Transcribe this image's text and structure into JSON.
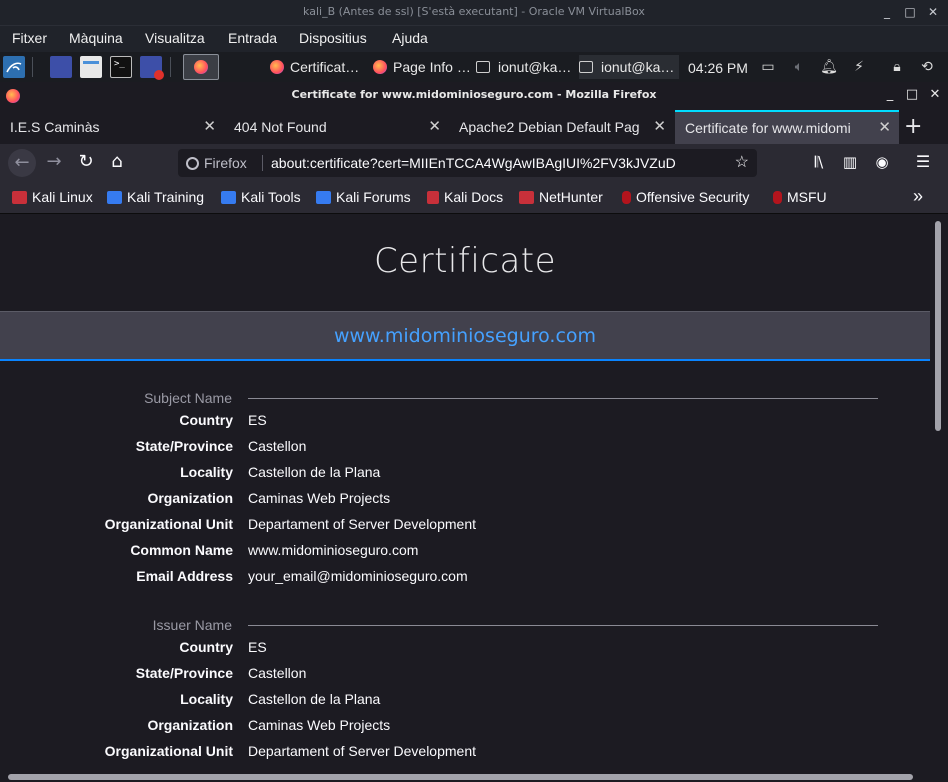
{
  "vbox": {
    "title": "kali_B (Antes de ssl) [S'està executant] - Oracle VM VirtualBox",
    "menu": [
      "Fitxer",
      "Màquina",
      "Visualitza",
      "Entrada",
      "Dispositius",
      "Ajuda"
    ]
  },
  "taskbar": {
    "tasks": [
      "Certificat…",
      "Page Info …",
      "ionut@ka…",
      "ionut@ka…"
    ],
    "clock": "04:26 PM"
  },
  "firefox": {
    "window_title": "Certificate for www.midominioseguro.com - Mozilla Firefox",
    "tabs": [
      {
        "label": "I.E.S Caminàs",
        "active": false
      },
      {
        "label": "404 Not Found",
        "active": false
      },
      {
        "label": "Apache2 Debian Default Pag",
        "active": false
      },
      {
        "label": "Certificate for www.midomi",
        "active": true
      }
    ],
    "identity_label": "Firefox",
    "url": "about:certificate?cert=MIIEnTCCA4WgAwIBAgIUI%2FV3kJVZuD",
    "bookmarks": [
      {
        "label": "Kali Linux",
        "icon": "kali-icon"
      },
      {
        "label": "Kali Training",
        "icon": "kali-training-icon"
      },
      {
        "label": "Kali Tools",
        "icon": "kali-tools-icon"
      },
      {
        "label": "Kali Forums",
        "icon": "kali-forums-icon"
      },
      {
        "label": "Kali Docs",
        "icon": "kali-docs-icon"
      },
      {
        "label": "NetHunter",
        "icon": "kali-icon"
      },
      {
        "label": "Offensive Security",
        "icon": "offsec-icon"
      },
      {
        "label": "MSFU",
        "icon": "offsec-icon"
      }
    ]
  },
  "page": {
    "title": "Certificate",
    "domain": "www.midominioseguro.com",
    "subject": {
      "heading": "Subject Name",
      "fields": [
        {
          "label": "Country",
          "value": "ES"
        },
        {
          "label": "State/Province",
          "value": "Castellon"
        },
        {
          "label": "Locality",
          "value": "Castellon de la Plana"
        },
        {
          "label": "Organization",
          "value": "Caminas Web Projects"
        },
        {
          "label": "Organizational Unit",
          "value": "Departament of Server Development"
        },
        {
          "label": "Common Name",
          "value": "www.midominioseguro.com"
        },
        {
          "label": "Email Address",
          "value": "your_email@midominioseguro.com"
        }
      ]
    },
    "issuer": {
      "heading": "Issuer Name",
      "fields": [
        {
          "label": "Country",
          "value": "ES"
        },
        {
          "label": "State/Province",
          "value": "Castellon"
        },
        {
          "label": "Locality",
          "value": "Castellon de la Plana"
        },
        {
          "label": "Organization",
          "value": "Caminas Web Projects"
        },
        {
          "label": "Organizational Unit",
          "value": "Departament of Server Development"
        }
      ]
    }
  },
  "colors": {
    "accent_link": "#45a1ff",
    "tab_active_top": "#00ddff",
    "domain_underline": "#0a84ff"
  }
}
